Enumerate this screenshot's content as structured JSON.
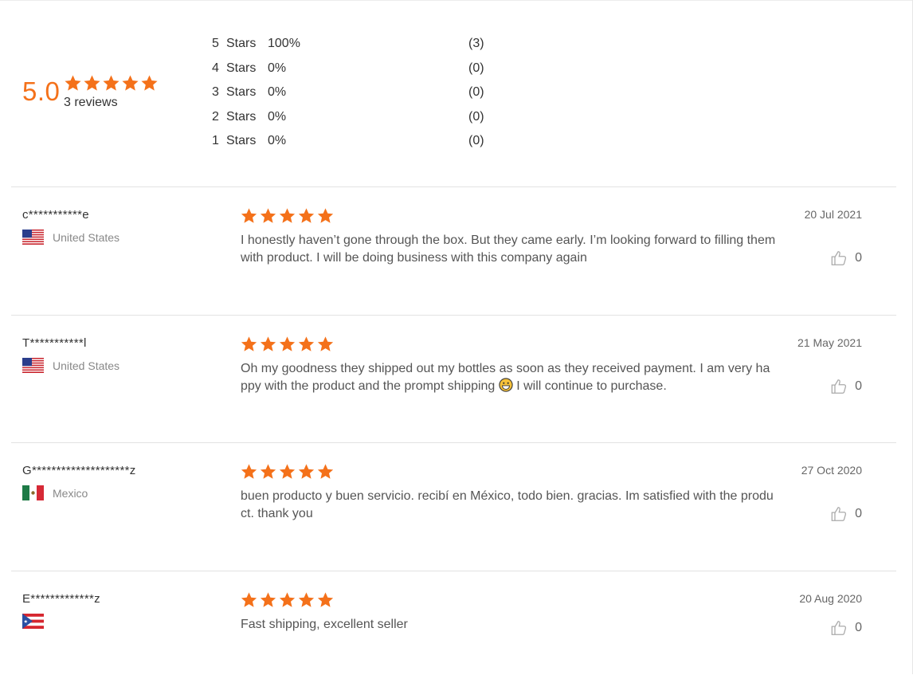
{
  "summary": {
    "average": "5.0",
    "review_count": "3 reviews",
    "distribution": [
      {
        "stars": "5",
        "label": "Stars",
        "percent": "100%",
        "fraction": 1.0,
        "count": "(3)"
      },
      {
        "stars": "4",
        "label": "Stars",
        "percent": "0%",
        "fraction": 0,
        "count": "(0)"
      },
      {
        "stars": "3",
        "label": "Stars",
        "percent": "0%",
        "fraction": 0,
        "count": "(0)"
      },
      {
        "stars": "2",
        "label": "Stars",
        "percent": "0%",
        "fraction": 0,
        "count": "(0)"
      },
      {
        "stars": "1",
        "label": "Stars",
        "percent": "0%",
        "fraction": 0,
        "count": "(0)"
      }
    ]
  },
  "colors": {
    "accent": "#f4711a",
    "divider": "#e2e2e2"
  },
  "reviews": [
    {
      "author": "c***********e",
      "country": "United States",
      "flag": "us-flag",
      "rating": 5,
      "date": "20 Jul 2021",
      "text": "I honestly haven’t gone through the box. But they came early. I’m looking forward to filling them with product. I will be doing business with this company again",
      "likes": "0"
    },
    {
      "author": "T***********l",
      "country": "United States",
      "flag": "us-flag",
      "rating": 5,
      "date": "21 May 2021",
      "text_before": "Oh my goodness they shipped out my bottles as soon as they received payment. I am very happy with the product and the prompt shipping ",
      "emoji": "grinning-face-emoji",
      "text_after": " I will continue to purchase.",
      "likes": "0"
    },
    {
      "author": "G********************z",
      "country": "Mexico",
      "flag": "mexico-flag",
      "rating": 5,
      "date": "27 Oct 2020",
      "text": "buen producto y buen servicio. recibí en México, todo bien. gracias. Im satisfied with the product. thank you",
      "likes": "0"
    },
    {
      "author": "E*************z",
      "country": "",
      "flag": "puerto-rico-flag",
      "rating": 5,
      "date": "20 Aug 2020",
      "text": "Fast shipping, excellent seller",
      "likes": "0"
    }
  ]
}
